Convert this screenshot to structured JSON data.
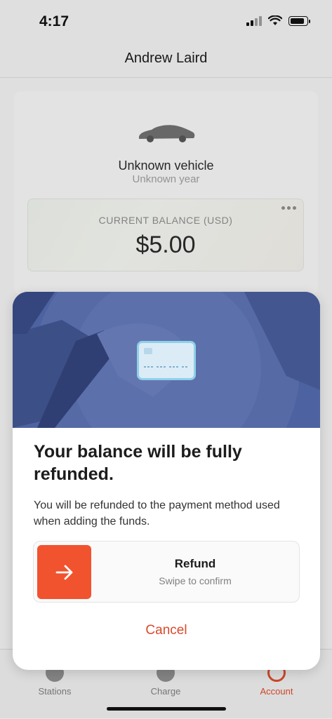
{
  "status_bar": {
    "time": "4:17",
    "icons": [
      "signal-icon",
      "wifi-icon",
      "battery-icon"
    ]
  },
  "header": {
    "title": "Andrew Laird"
  },
  "profile": {
    "vehicle_name": "Unknown vehicle",
    "vehicle_year": "Unknown year",
    "balance_label": "CURRENT BALANCE (USD)",
    "balance_value": "$5.00"
  },
  "tab_bar": {
    "items": [
      {
        "label": "Stations",
        "icon": "stations-icon"
      },
      {
        "label": "Charge",
        "icon": "charge-icon"
      },
      {
        "label": "Account",
        "icon": "account-icon",
        "active": true
      }
    ]
  },
  "modal": {
    "title": "Your balance will be fully refunded.",
    "description": "You will be refunded to the payment method used when adding the funds.",
    "swipe_title": "Refund",
    "swipe_subtitle": "Swipe to confirm",
    "cancel_label": "Cancel"
  },
  "colors": {
    "accent": "#f1532e",
    "cancel_text": "#d94a2b",
    "hero_overlay": "#4a5e9b"
  }
}
